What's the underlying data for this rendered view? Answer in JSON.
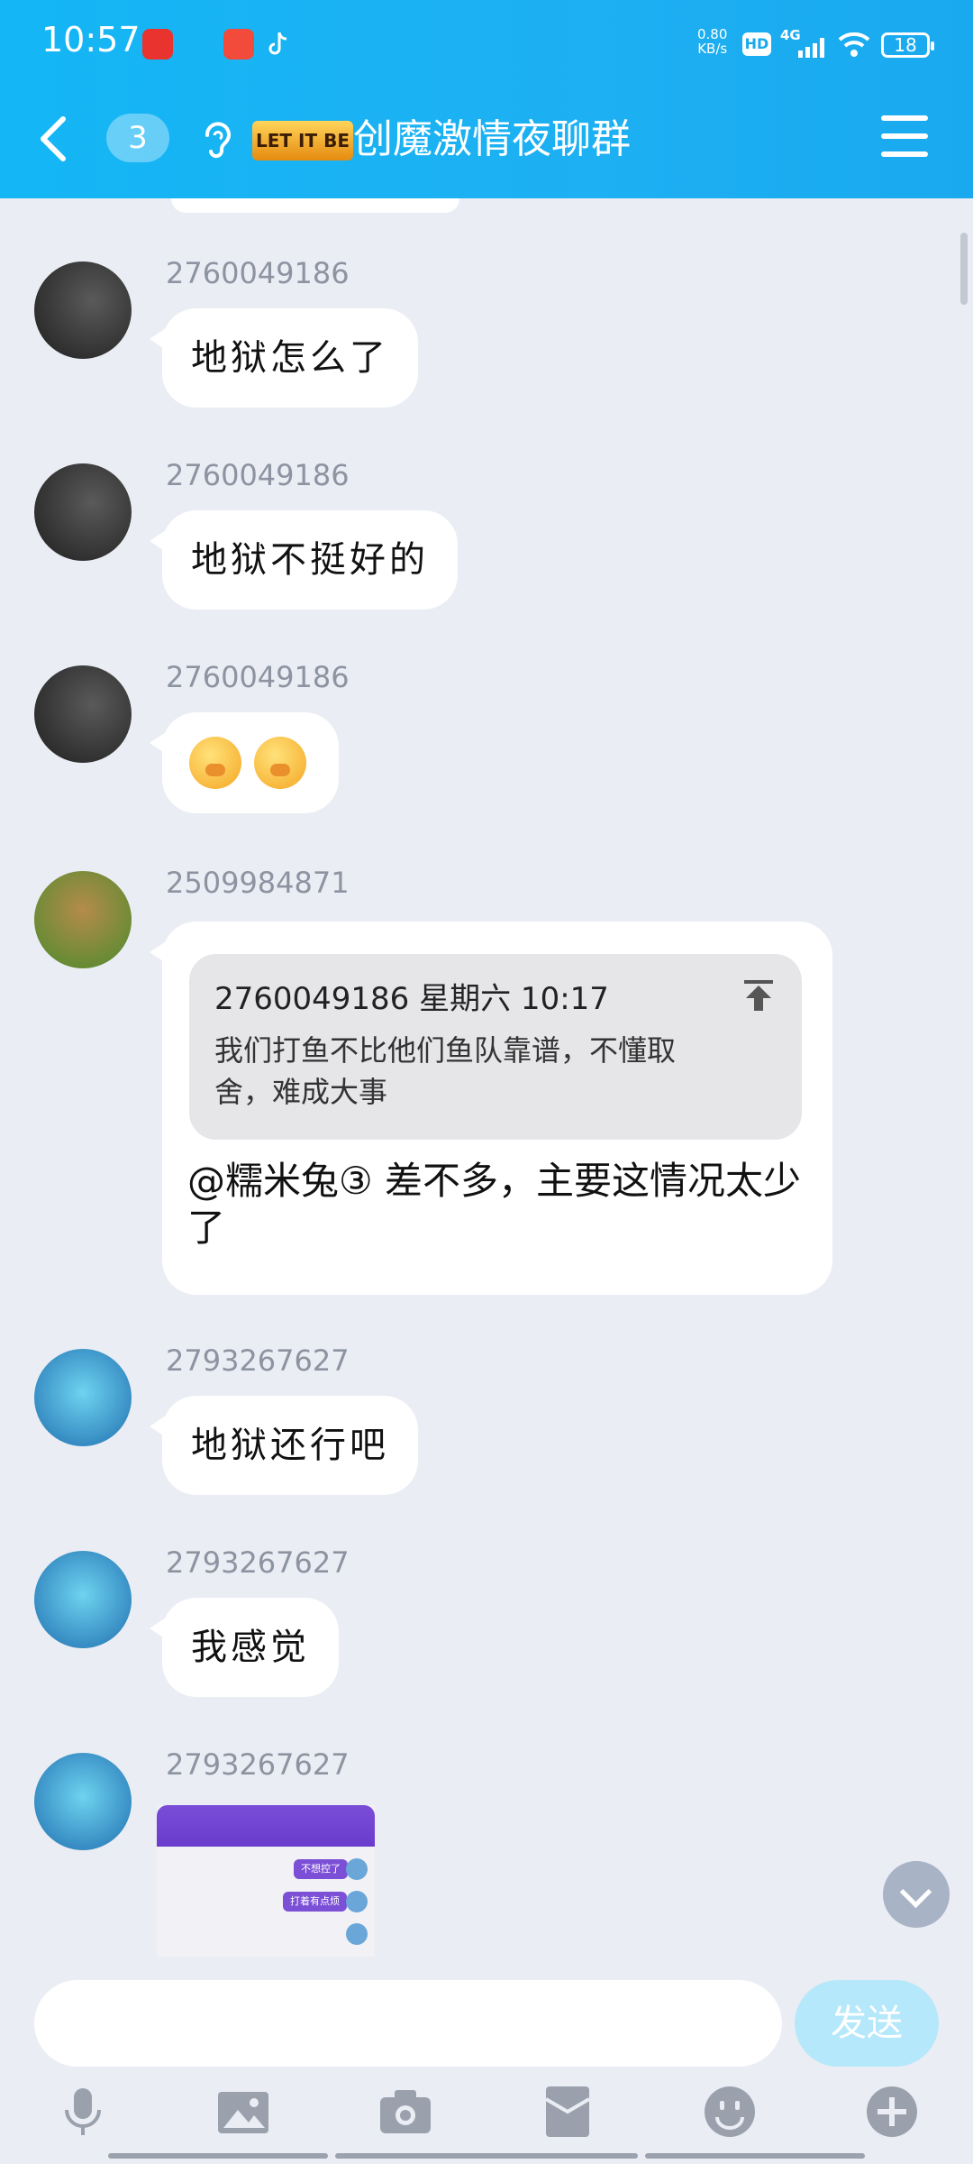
{
  "status": {
    "time": "10:57",
    "net_speed": "0.80",
    "net_unit": "KB/s",
    "hd": "HD",
    "signal": "4G",
    "battery": "18"
  },
  "header": {
    "badge": "3",
    "logo_text": "LET IT BE",
    "title": "创魔激情夜聊群"
  },
  "messages": [
    {
      "uid": "2760049186",
      "text": "地狱怎么了"
    },
    {
      "uid": "2760049186",
      "text": "地狱不挺好的"
    },
    {
      "uid": "2760049186",
      "emoji": [
        "thinking-face-emoji",
        "thinking-face-emoji"
      ]
    },
    {
      "uid": "2509984871",
      "quote_head": "2760049186 星期六 10:17",
      "quote_body": "我们打鱼不比他们鱼队靠谱，不懂取舍，难成大事",
      "reply": "@糯米兔③ 差不多，主要这情况太少了"
    },
    {
      "uid": "2793267627",
      "text": "地狱还行吧"
    },
    {
      "uid": "2793267627",
      "text": "我感觉"
    },
    {
      "uid": "2793267627",
      "image": "chat-screenshot-thumbnail",
      "thumb_lines": [
        "不想控了",
        "打着有点烦"
      ]
    }
  ],
  "input": {
    "send_label": "发送"
  },
  "toolbar": [
    "microphone-icon",
    "image-icon",
    "camera-icon",
    "red-packet-icon",
    "emoji-icon",
    "plus-icon"
  ],
  "colors": {
    "header": "#1db0f2",
    "background": "#eaedf3",
    "send_disabled": "#b6e8fb"
  }
}
